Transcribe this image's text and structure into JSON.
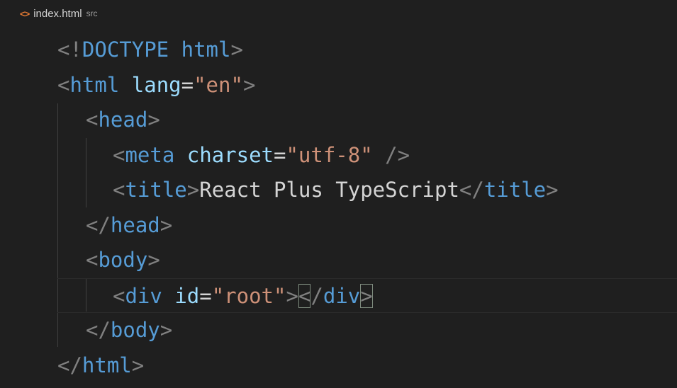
{
  "breadcrumb": {
    "icon": "code-file-icon",
    "file": "index.html",
    "folder": "src"
  },
  "code": {
    "line1": {
      "lt": "<!",
      "doctype": "DOCTYPE",
      "space": " ",
      "html": "html",
      "gt": ">"
    },
    "line2": {
      "lt": "<",
      "tag": "html",
      "sp": " ",
      "attr": "lang",
      "eq": "=",
      "val": "\"en\"",
      "gt": ">"
    },
    "line3": {
      "lt": "<",
      "tag": "head",
      "gt": ">"
    },
    "line4": {
      "lt": "<",
      "tag": "meta",
      "sp": " ",
      "attr": "charset",
      "eq": "=",
      "val": "\"utf-8\"",
      "end": " />"
    },
    "line5": {
      "lt": "<",
      "tag": "title",
      "gt": ">",
      "text": "React Plus TypeScript",
      "close": "</",
      "ctag": "title",
      "cgt": ">"
    },
    "line6": {
      "lt": "</",
      "tag": "head",
      "gt": ">"
    },
    "line7": {
      "lt": "<",
      "tag": "body",
      "gt": ">"
    },
    "line8": {
      "lt": "<",
      "tag": "div",
      "sp": " ",
      "attr": "id",
      "eq": "=",
      "val": "\"root\"",
      "gt": ">",
      "close": "<",
      "slash": "/",
      "ctag": "div",
      "cgt": ">"
    },
    "line9": {
      "lt": "</",
      "tag": "body",
      "gt": ">"
    },
    "line10": {
      "lt": "</",
      "tag": "html",
      "gt": ">"
    }
  },
  "colors": {
    "background": "#1f1f1f",
    "tag": "#569cd6",
    "attribute": "#9cdcfe",
    "string": "#ce9178",
    "bracket": "#808080",
    "text": "#d4d4d4",
    "file_icon": "#e37933"
  }
}
